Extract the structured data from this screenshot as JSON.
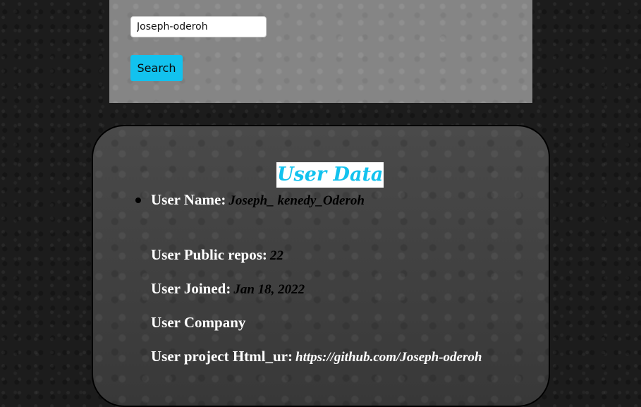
{
  "search": {
    "input_value": "Joseph-oderoh",
    "button_label": "Search"
  },
  "user_data": {
    "title": "User Data",
    "rows": [
      {
        "label": "User Name:",
        "value": "Joseph_ kenedy_Oderoh"
      },
      {
        "label": "User Public repos:",
        "value": "22"
      },
      {
        "label": "User Joined:",
        "value": "Jan 18, 2022"
      },
      {
        "label": "User Company",
        "value": ""
      },
      {
        "label": "User project Html_ur:",
        "value": "https://github.com/Joseph-oderoh"
      }
    ]
  },
  "colors": {
    "accent": "#12c2ee",
    "panel": "#858585",
    "card": "#3d3d3d"
  }
}
